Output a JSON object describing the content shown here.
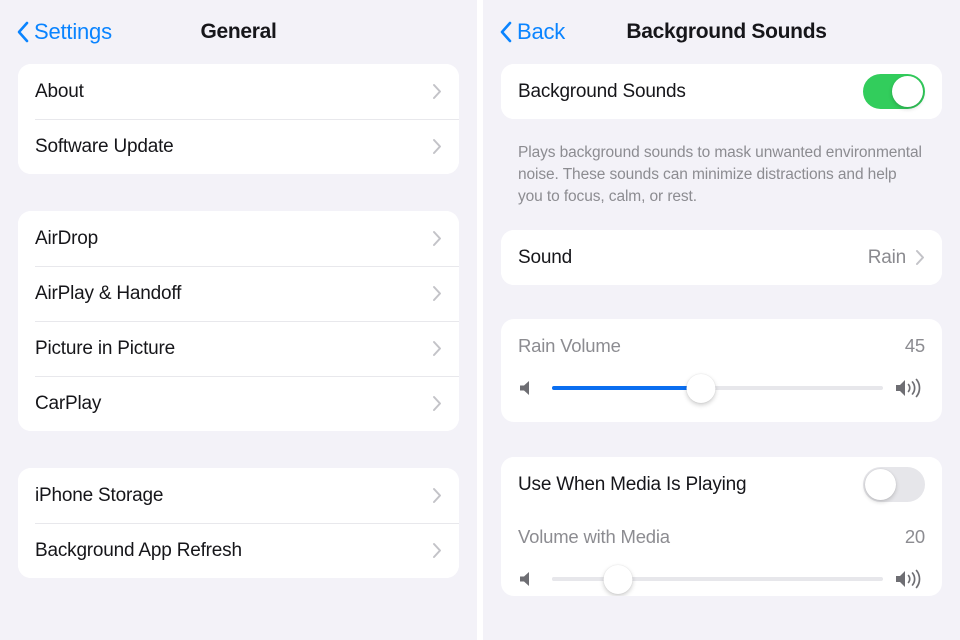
{
  "left_screen": {
    "nav": {
      "back_label": "Settings",
      "back_icon": "chevron-left-icon",
      "title": "General"
    },
    "groups": [
      {
        "rows": [
          {
            "label": "About",
            "accessory": "chevron-right-icon"
          },
          {
            "label": "Software Update",
            "accessory": "chevron-right-icon"
          }
        ]
      },
      {
        "rows": [
          {
            "label": "AirDrop",
            "accessory": "chevron-right-icon"
          },
          {
            "label": "AirPlay & Handoff",
            "accessory": "chevron-right-icon"
          },
          {
            "label": "Picture in Picture",
            "accessory": "chevron-right-icon"
          },
          {
            "label": "CarPlay",
            "accessory": "chevron-right-icon"
          }
        ]
      },
      {
        "rows": [
          {
            "label": "iPhone Storage",
            "accessory": "chevron-right-icon"
          },
          {
            "label": "Background App Refresh",
            "accessory": "chevron-right-icon"
          }
        ]
      }
    ]
  },
  "right_screen": {
    "nav": {
      "back_label": "Back",
      "back_icon": "chevron-left-icon",
      "title": "Background Sounds"
    },
    "master_toggle": {
      "label": "Background Sounds",
      "state": "on",
      "on_color": "#32cd5c"
    },
    "footnote": "Plays background sounds to mask unwanted environmental noise. These sounds can minimize distractions and help you to focus, calm, or rest.",
    "sound_row": {
      "label": "Sound",
      "value": "Rain",
      "accessory": "chevron-right-icon"
    },
    "rain_volume": {
      "label": "Rain Volume",
      "value": "45",
      "percent": 45,
      "min_icon": "speaker-low-icon",
      "max_icon": "speaker-high-icon",
      "fill_color": "#0a6ef0"
    },
    "media_toggle": {
      "label": "Use When Media Is Playing",
      "state": "off"
    },
    "media_volume": {
      "label": "Volume with Media",
      "value": "20",
      "percent": 20,
      "min_icon": "speaker-low-icon",
      "max_icon": "speaker-high-icon"
    }
  }
}
